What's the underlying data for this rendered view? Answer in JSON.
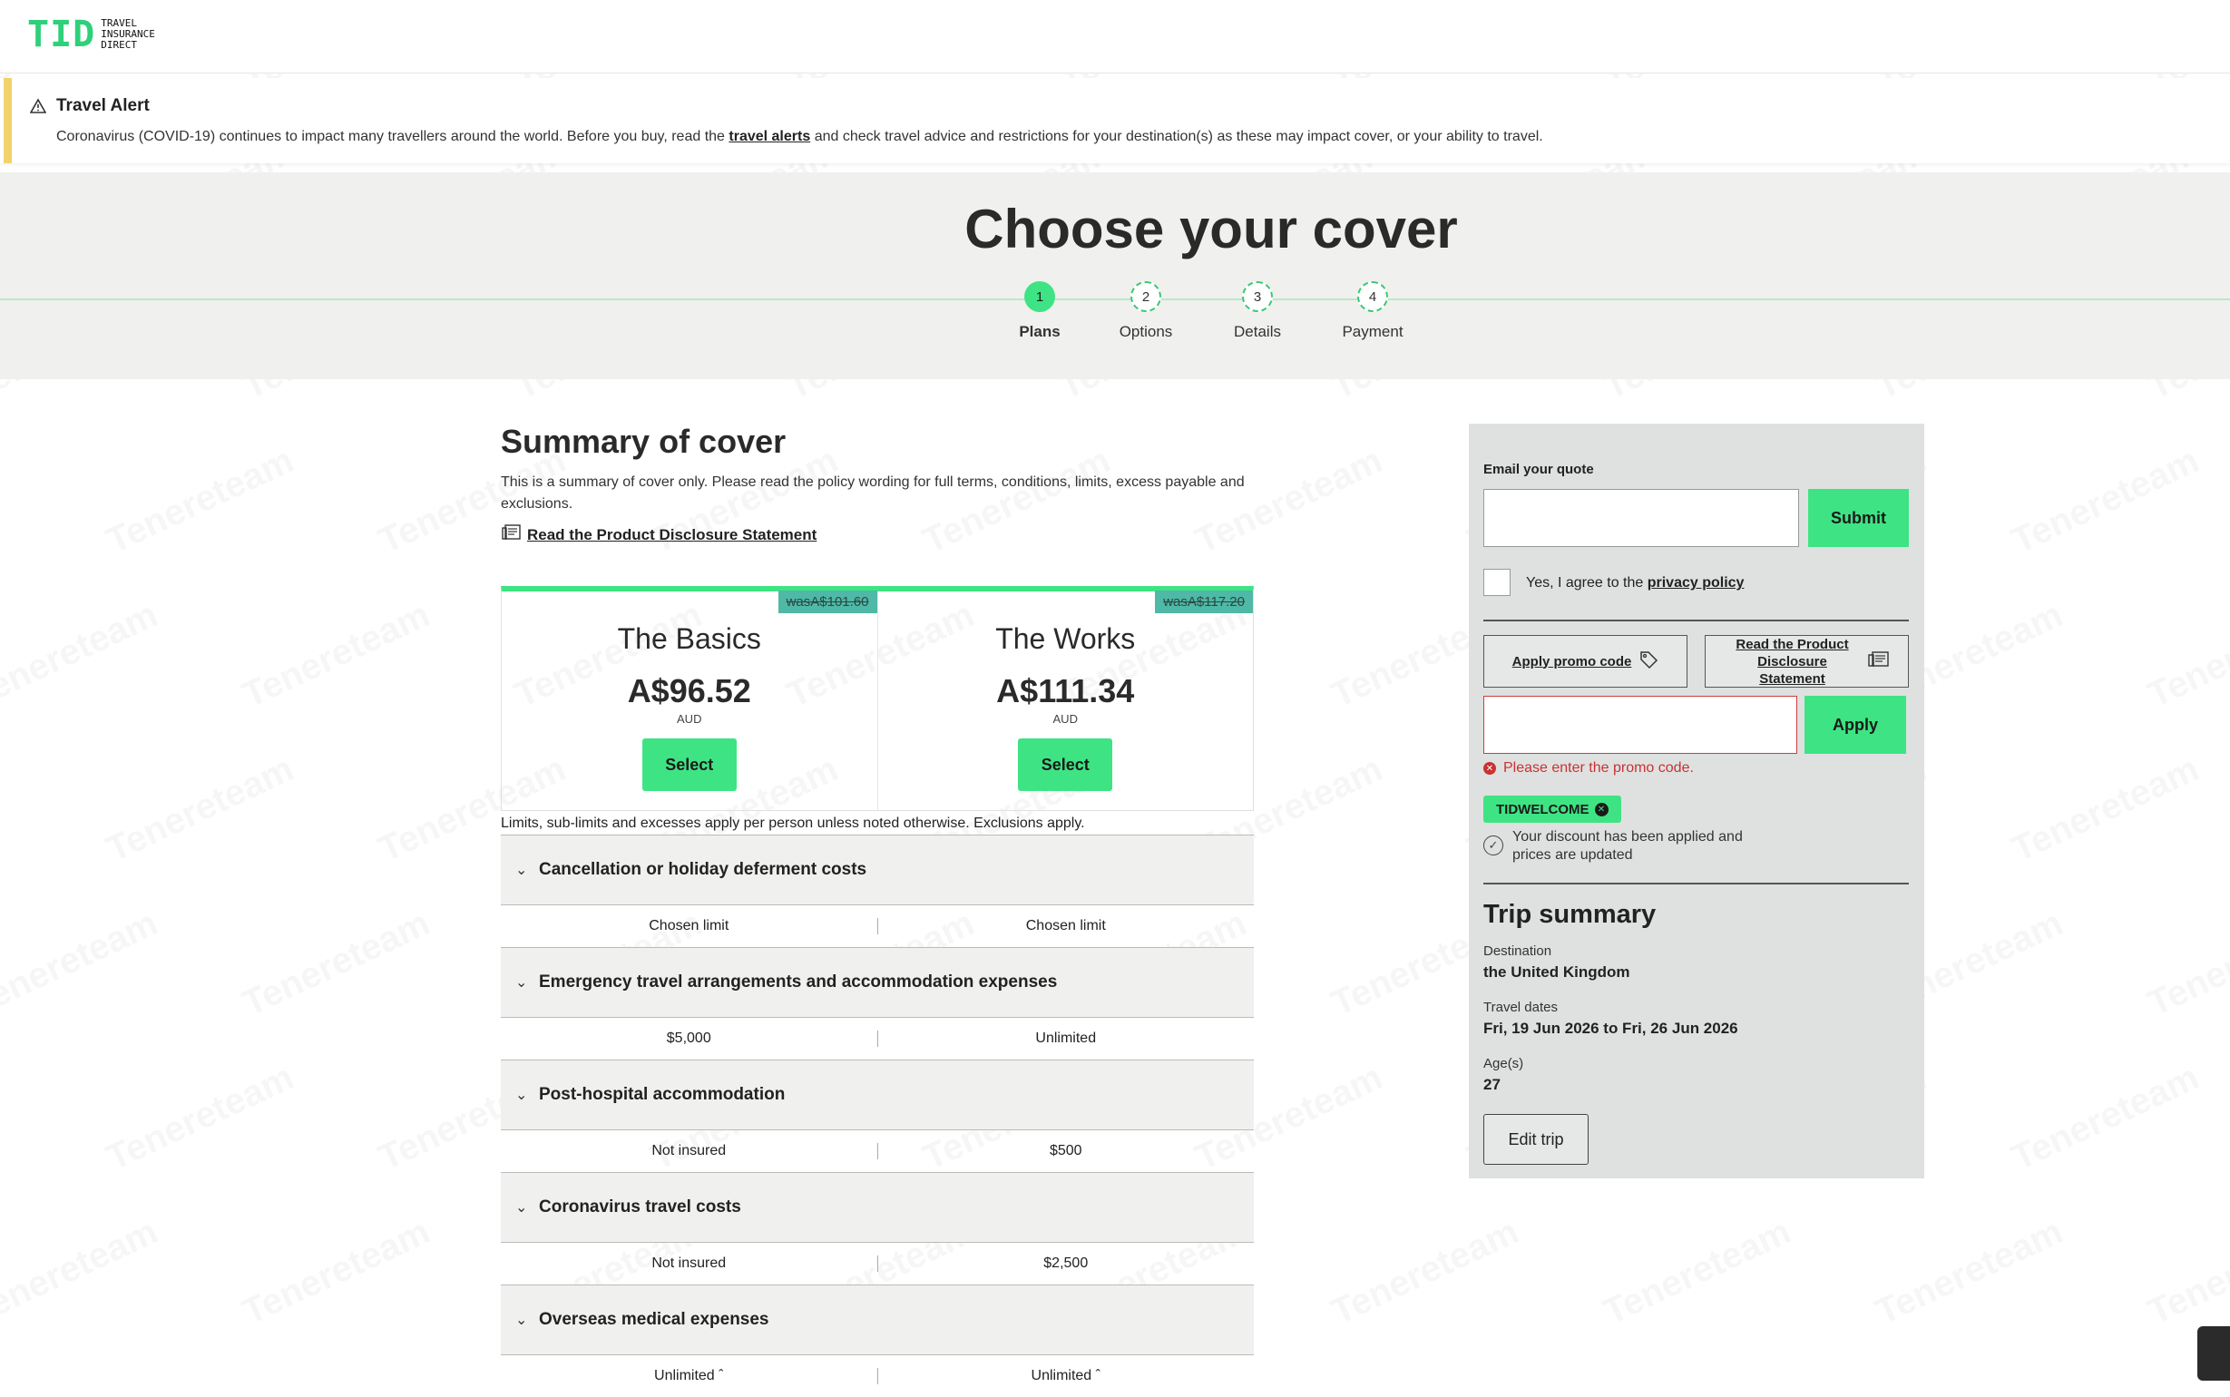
{
  "header": {
    "logo_mark": "TID",
    "logo_text": "TRAVEL INSURANCE DIRECT"
  },
  "alert": {
    "icon": "warning-icon",
    "title": "Travel Alert",
    "message_before": "Coronavirus (COVID-19) continues to impact many travellers around the world. Before you buy, read the",
    "link": "travel alerts",
    "message_after": "and check travel advice and restrictions for your destination(s) as these may impact cover, or your ability to travel."
  },
  "hero": {
    "title": "Choose your cover",
    "steps": [
      {
        "num": "1",
        "label": "Plans",
        "active": true
      },
      {
        "num": "2",
        "label": "Options",
        "active": false
      },
      {
        "num": "3",
        "label": "Details",
        "active": false
      },
      {
        "num": "4",
        "label": "Payment",
        "active": false
      }
    ]
  },
  "summary": {
    "title": "Summary of cover",
    "description": "This is a summary of cover only. Please read the policy wording for full terms, conditions, limits, excess payable and exclusions.",
    "pds_link": "Read the Product Disclosure Statement",
    "limits_note": "Limits, sub-limits and excesses apply per person unless noted otherwise. Exclusions apply."
  },
  "plans": [
    {
      "was": "wasA$101.60",
      "name": "The Basics",
      "price": "A$96.52",
      "currency": "AUD",
      "button": "Select"
    },
    {
      "was": "wasA$117.20",
      "name": "The Works",
      "price": "A$111.34",
      "currency": "AUD",
      "button": "Select"
    }
  ],
  "benefits": [
    {
      "title": "Cancellation or holiday deferment costs",
      "basics": "Chosen limit",
      "works": "Chosen limit"
    },
    {
      "title": "Emergency travel arrangements and accommodation expenses",
      "basics": "$5,000",
      "works": "Unlimited"
    },
    {
      "title": "Post-hospital accommodation",
      "basics": "Not insured",
      "works": "$500"
    },
    {
      "title": "Coronavirus travel costs",
      "basics": "Not insured",
      "works": "$2,500"
    },
    {
      "title": "Overseas medical expenses",
      "basics": "Unlimited ˆ",
      "works": "Unlimited ˆ"
    }
  ],
  "sidebar": {
    "email_label": "Email your quote",
    "email_value": "",
    "submit": "Submit",
    "agree_text": "Yes, I agree to the",
    "privacy_link": "privacy policy",
    "promo_button": "Apply promo code",
    "pds_button": "Read the Product Disclosure Statement",
    "promo_value": "",
    "apply": "Apply",
    "error": "Please enter the promo code.",
    "promo_chip": "TIDWELCOME",
    "discount_msg": "Your discount has been applied and prices are updated",
    "trip_title": "Trip summary",
    "destination_label": "Destination",
    "destination": "the United Kingdom",
    "dates_label": "Travel dates",
    "dates": "Fri, 19 Jun 2026 to Fri, 26 Jun 2026",
    "ages_label": "Age(s)",
    "ages": "27",
    "edit": "Edit trip"
  },
  "watermark": "Tenereteam",
  "colors": {
    "accent": "#3ee483",
    "alert_bar": "#f0d36a",
    "was_tag": "#4fb8a6",
    "error": "#c83232",
    "panel": "#dfe1e0"
  }
}
